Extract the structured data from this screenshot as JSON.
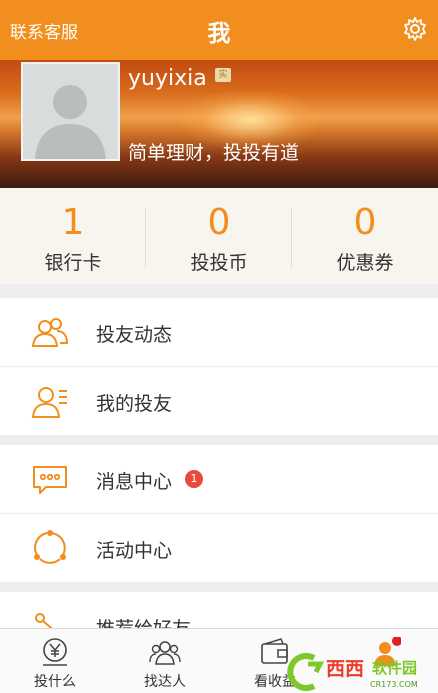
{
  "header": {
    "contact_label": "联系客服",
    "title": "我",
    "settings_icon": "gear-icon"
  },
  "profile": {
    "username": "yuyixia",
    "badge": "实",
    "motto": "简单理财，投投有道",
    "avatar_icon": "default-avatar"
  },
  "stats": [
    {
      "value": "1",
      "label": "银行卡"
    },
    {
      "value": "0",
      "label": "投投币"
    },
    {
      "value": "0",
      "label": "优惠券"
    }
  ],
  "menu": {
    "friends_activity": "投友动态",
    "my_friends": "我的投友",
    "messages": "消息中心",
    "messages_count": "1",
    "events": "活动中心",
    "recommend": "推荐给好友"
  },
  "tabs": [
    {
      "label": "投什么",
      "icon": "yen-coin-icon"
    },
    {
      "label": "找达人",
      "icon": "people-icon"
    },
    {
      "label": "看收益",
      "icon": "wallet-icon"
    },
    {
      "label": "",
      "icon": "me-icon"
    }
  ],
  "watermark": {
    "text": "西西软件园",
    "subtext": "CR173.COM"
  },
  "colors": {
    "accent": "#f28e1e",
    "notification": "#e84a3c"
  }
}
